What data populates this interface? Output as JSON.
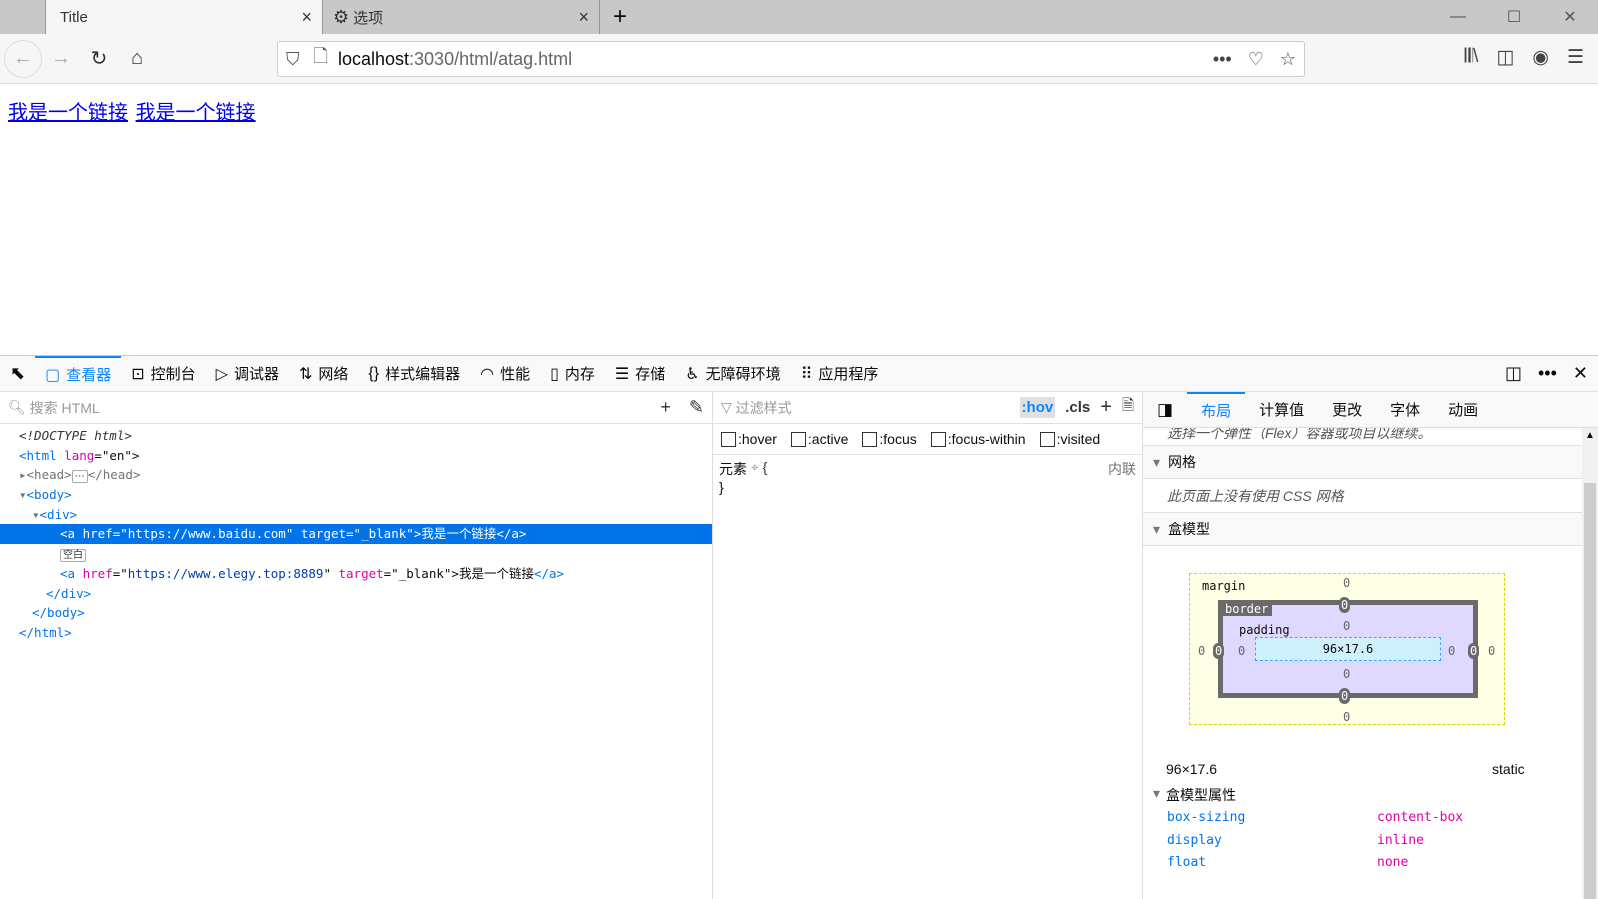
{
  "browser": {
    "tabs": [
      {
        "label": "Title",
        "close": "×"
      },
      {
        "label": "选项",
        "icon": "gear-icon",
        "close": "×"
      }
    ],
    "new_tab": "+",
    "url_host": "localhost",
    "url_path": ":3030/html/atag.html",
    "win": [
      "—",
      "☐",
      "✕"
    ]
  },
  "page": {
    "links": [
      "我是一个链接",
      "我是一个链接"
    ]
  },
  "devtools": {
    "tabs": [
      "查看器",
      "控制台",
      "调试器",
      "网络",
      "样式编辑器",
      "性能",
      "内存",
      "存储",
      "无障碍环境",
      "应用程序"
    ],
    "search_placeholder": "搜索 HTML",
    "tree": {
      "doctype": "<!DOCTYPE html>",
      "html_open": "<html",
      "lang_attr": "lang",
      "lang_val": "\"en\"",
      "head_open": "<head>",
      "head_close": "</head>",
      "body_open": "<body>",
      "div_open": "<div>",
      "a1_href": "https://www.baidu.com",
      "a1_text": "我是一个链接",
      "blank": "空白",
      "a2_href": "https://www.elegy.top:8889",
      "a2_text": "我是一个链接",
      "div_close": "</div>",
      "body_close": "</body>",
      "html_close": "</html>"
    },
    "rules": {
      "filter_placeholder": "过滤样式",
      "hov": ":hov",
      "cls": ".cls",
      "pseudo": [
        ":hover",
        ":active",
        ":focus",
        ":focus-within",
        ":visited"
      ],
      "element": "元素",
      "inline": "内联"
    },
    "layout": {
      "tabs": [
        "布局",
        "计算值",
        "更改",
        "字体",
        "动画"
      ],
      "flex_note": "选择一个弹性（Flex）容器或项目以继续。",
      "grid_title": "网格",
      "grid_note": "此页面上没有使用 CSS 网格",
      "boxmodel_title": "盒模型",
      "margin_label": "margin",
      "border_label": "border",
      "padding_label": "padding",
      "content_size": "96×17.6",
      "zero": "0",
      "size": "96×17.6",
      "position": "static",
      "props_title": "盒模型属性",
      "props": [
        {
          "k": "box-sizing",
          "v": "content-box"
        },
        {
          "k": "display",
          "v": "inline"
        },
        {
          "k": "float",
          "v": "none"
        }
      ]
    }
  }
}
